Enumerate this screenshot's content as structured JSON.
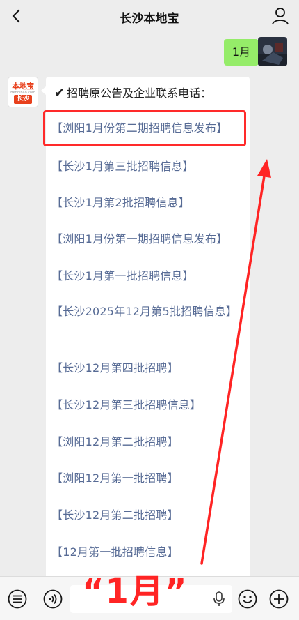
{
  "header": {
    "title": "长沙本地宝"
  },
  "messages": {
    "outgoing": "1月",
    "account_avatar": {
      "brand": "本地宝",
      "site": "Bendibao.com",
      "city": "长沙"
    }
  },
  "bubble": {
    "heading_mark": "✔",
    "heading": "招聘原公告及企业联系电话：",
    "links": [
      "【浏阳1月份第二期招聘信息发布】",
      "【长沙1月第三批招聘信息】",
      "【长沙1月第2批招聘信息】",
      "【浏阳1月份第一期招聘信息发布】",
      "【长沙1月第一批招聘信息】",
      "【长沙2025年12月第5批招聘信息】",
      "【长沙12月第四批招聘】",
      "【长沙12月第三批招聘信息】",
      "【浏阳12月第二批招聘】",
      "【浏阳12月第一批招聘】",
      "【长沙12月第二批招聘】",
      "【12月第一批招聘信息】"
    ]
  },
  "annotation": {
    "text": "“1月”",
    "color": "#ff2424"
  },
  "colors": {
    "link": "#576b95",
    "outgoing_bubble": "#95ec69",
    "highlight": "#ff2a2a"
  },
  "icons": [
    "back-icon",
    "profile-icon",
    "menu-icon",
    "voice-icon",
    "mic-icon",
    "emoji-icon",
    "plus-icon"
  ]
}
